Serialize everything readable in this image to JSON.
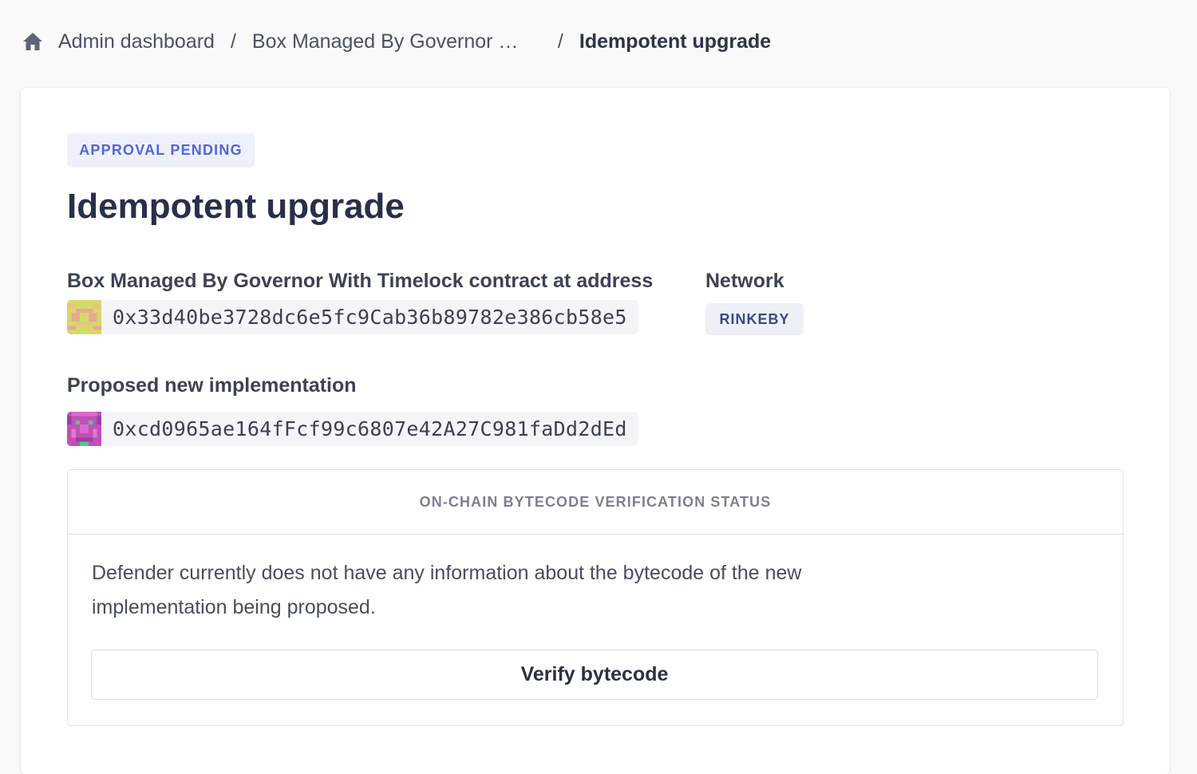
{
  "breadcrumb": {
    "home_icon": "home-icon",
    "items": [
      "Admin dashboard",
      "Box Managed By Governor With Timelock"
    ],
    "separator": "/",
    "current": "Idempotent upgrade"
  },
  "proposal": {
    "status": "APPROVAL PENDING",
    "title": "Idempotent upgrade",
    "contract_label": "Box Managed By Governor With Timelock contract at address",
    "contract_address": "0x33d40be3728dc6e5fc9Cab36b89782e386cb58e5",
    "network_label": "Network",
    "network": "RINKEBY",
    "implementation_label": "Proposed new implementation",
    "implementation_address": "0xcd0965ae164fFcf99c6807e42A27C981faDd2dEd"
  },
  "verification": {
    "header": "ON-CHAIN BYTECODE VERIFICATION STATUS",
    "message": "Defender currently does not have any information about the bytecode of the new implementation being proposed.",
    "button_label": "Verify bytecode"
  },
  "colors": {
    "status_badge_text": "#5566d6",
    "network_badge_text": "#3a4a86",
    "title": "#27304a"
  }
}
